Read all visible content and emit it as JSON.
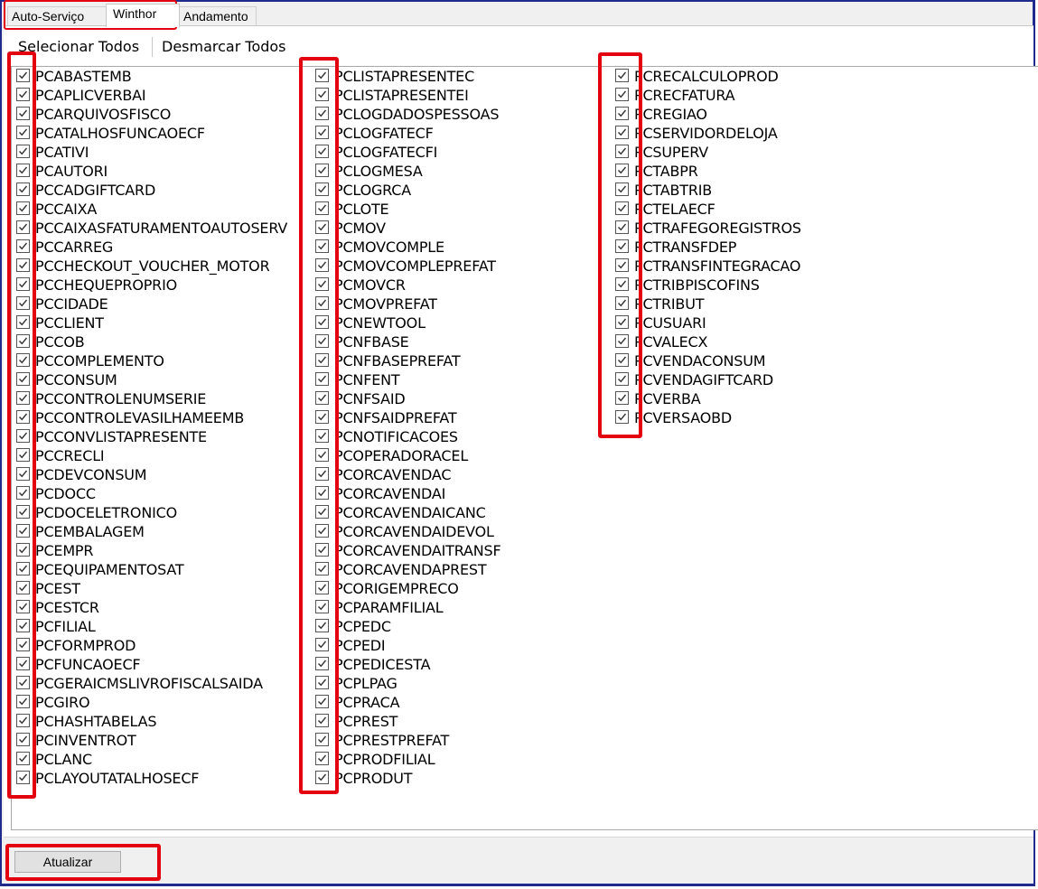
{
  "tabs": [
    {
      "label": "Auto-Serviço"
    },
    {
      "label": "Winthor"
    },
    {
      "label": "Andamento"
    }
  ],
  "toolbar": {
    "select_all": "Selecionar Todos",
    "deselect_all": "Desmarcar Todos"
  },
  "columns": [
    [
      "PCABASTEMB",
      "PCAPLICVERBAI",
      "PCARQUIVOSFISCO",
      "PCATALHOSFUNCAOECF",
      "PCATIVI",
      "PCAUTORI",
      "PCCADGIFTCARD",
      "PCCAIXA",
      "PCCAIXASFATURAMENTOAUTOSERV",
      "PCCARREG",
      "PCCHECKOUT_VOUCHER_MOTOR",
      "PCCHEQUEPROPRIO",
      "PCCIDADE",
      "PCCLIENT",
      "PCCOB",
      "PCCOMPLEMENTO",
      "PCCONSUM",
      "PCCONTROLENUMSERIE",
      "PCCONTROLEVASILHAMEEMB",
      "PCCONVLISTAPRESENTE",
      "PCCRECLI",
      "PCDEVCONSUM",
      "PCDOCC",
      "PCDOCELETRONICO",
      "PCEMBALAGEM",
      "PCEMPR",
      "PCEQUIPAMENTOSAT",
      "PCEST",
      "PCESTCR",
      "PCFILIAL",
      "PCFORMPROD",
      "PCFUNCAOECF",
      "PCGERAICMSLIVROFISCALSAIDA",
      "PCGIRO",
      "PCHASHTABELAS",
      "PCINVENTROT",
      "PCLANC",
      "PCLAYOUTATALHOSECF"
    ],
    [
      "PCLISTAPRESENTEC",
      "PCLISTAPRESENTEI",
      "PCLOGDADOSPESSOAS",
      "PCLOGFATECF",
      "PCLOGFATECFI",
      "PCLOGMESA",
      "PCLOGRCA",
      "PCLOTE",
      "PCMOV",
      "PCMOVCOMPLE",
      "PCMOVCOMPLEPREFAT",
      "PCMOVCR",
      "PCMOVPREFAT",
      "PCNEWTOOL",
      "PCNFBASE",
      "PCNFBASEPREFAT",
      "PCNFENT",
      "PCNFSAID",
      "PCNFSAIDPREFAT",
      "PCNOTIFICACOES",
      "PCOPERADORACEL",
      "PCORCAVENDAC",
      "PCORCAVENDAI",
      "PCORCAVENDAICANC",
      "PCORCAVENDAIDEVOL",
      "PCORCAVENDAITRANSF",
      "PCORCAVENDAPREST",
      "PCORIGEMPRECO",
      "PCPARAMFILIAL",
      "PCPEDC",
      "PCPEDI",
      "PCPEDICESTA",
      "PCPLPAG",
      "PCPRACA",
      "PCPREST",
      "PCPRESTPREFAT",
      "PCPRODFILIAL",
      "PCPRODUT"
    ],
    [
      "PCRECALCULOPROD",
      "PCRECFATURA",
      "PCREGIAO",
      "PCSERVIDORDELOJA",
      "PCSUPERV",
      "PCTABPR",
      "PCTABTRIB",
      "PCTELAECF",
      "PCTRAFEGOREGISTROS",
      "PCTRANSFDEP",
      "PCTRANSFINTEGRACAO",
      "PCTRIBPISCOFINS",
      "PCTRIBUT",
      "PCUSUARI",
      "PCVALECX",
      "PCVENDACONSUM",
      "PCVENDAGIFTCARD",
      "PCVERBA",
      "PCVERSAOBD"
    ]
  ],
  "checked": true,
  "footer": {
    "update_button": "Atualizar"
  },
  "colors": {
    "highlight": "#e3000f",
    "frame": "#1f2a8c"
  }
}
